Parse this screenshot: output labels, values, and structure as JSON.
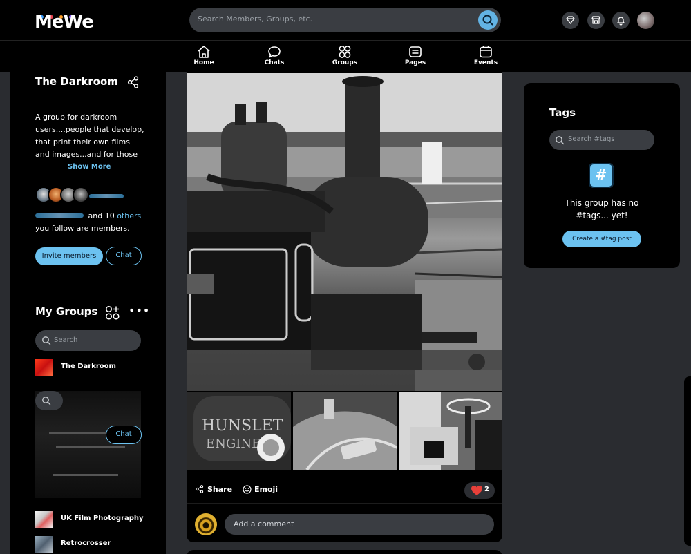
{
  "brand": {
    "name": "MeWe",
    "dot_colors": [
      "#3fa0ff",
      "#e8434f",
      "#ff9f2a",
      "#8a5cf6"
    ]
  },
  "search": {
    "placeholder": "Search Members, Groups, etc."
  },
  "top_icons": [
    "diamond-icon",
    "store-icon",
    "bell-icon"
  ],
  "nav": {
    "items": [
      {
        "label": "Home",
        "icon": "home-icon"
      },
      {
        "label": "Chats",
        "icon": "chat-bubble-icon"
      },
      {
        "label": "Groups",
        "icon": "groups-icon"
      },
      {
        "label": "Pages",
        "icon": "pages-icon"
      },
      {
        "label": "Events",
        "icon": "calendar-icon"
      }
    ]
  },
  "group": {
    "title": "The Darkroom",
    "description": "A group for darkroom users....people that develop, that print their own films and images...and for those",
    "show_more": "Show More",
    "members_text_1": "and 10",
    "members_link": "others",
    "members_text_2": "you follow are members.",
    "invite_label": "Invite members",
    "chat_label": "Chat"
  },
  "my_groups": {
    "title": "My Groups",
    "search_placeholder": "Search",
    "items": [
      {
        "name": "The Darkroom"
      },
      {
        "name": "UK Film Photography"
      },
      {
        "name": "Retrocrosser"
      }
    ],
    "chat_label": "Chat"
  },
  "post": {
    "share_label": "Share",
    "emoji_label": "Emoji",
    "reaction_count": "2",
    "comment_placeholder": "Add a comment"
  },
  "tags": {
    "title": "Tags",
    "search_placeholder": "Search #tags",
    "empty_text": "This group has no #tags... yet!",
    "create_label": "Create a #tag post"
  },
  "colors": {
    "accent": "#6cc2f0",
    "background": "#2a2c30",
    "panel": "#000000",
    "input": "#3a3d42",
    "heart": "#e8403a"
  }
}
